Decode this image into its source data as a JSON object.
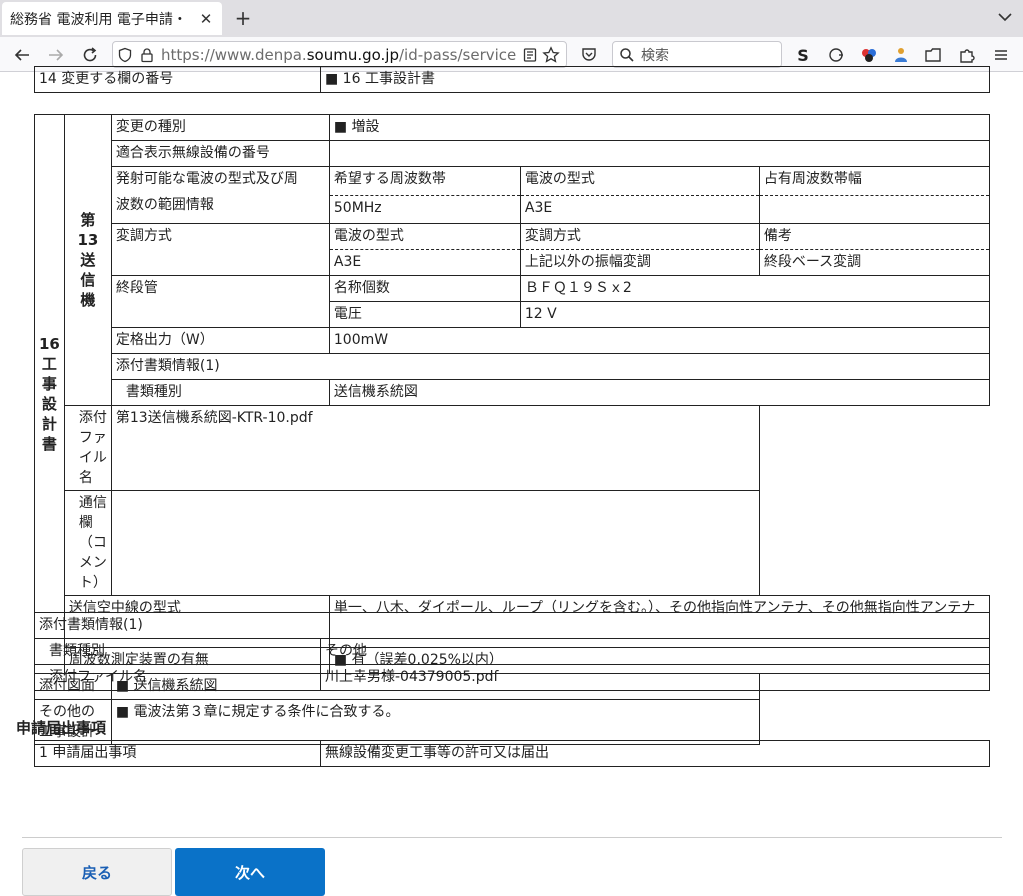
{
  "browser": {
    "tab_title": "総務省 電波利用 電子申請・",
    "close_glyph": "✕",
    "newtab_glyph": "+",
    "url_prefix": "https://www.denpa.",
    "url_host": "soumu.go.jp",
    "url_path": "/id-pass/service",
    "search_placeholder": "検索",
    "icons": [
      "back-arrow",
      "forward-arrow",
      "reload",
      "shield",
      "lock",
      "reader",
      "star",
      "pocket",
      "search",
      "ext-s",
      "ext-g",
      "ext-balls",
      "ext-puzzle-person",
      "container",
      "extensions",
      "menu"
    ]
  },
  "top_row": {
    "label": "14 変更する欄の番号",
    "value": "■ 16 工事設計書"
  },
  "design": {
    "outer_label": "16工事設計書",
    "outer_chars": [
      "16",
      "工",
      "事",
      "設",
      "計",
      "書"
    ],
    "tx_chars": [
      "第",
      "13",
      "送",
      "信",
      "機"
    ],
    "change_type_label": "変更の種別",
    "change_type_value": "■ 増設",
    "conform_label": "適合表示無線設備の番号",
    "conform_value": "",
    "freq_label": "発射可能な電波の型式及び周波数の範囲情報",
    "freq_label_line1": "発射可能な電波の型式及び周",
    "freq_label_line2": "波数の範囲情報",
    "freq_headers": [
      "希望する周波数帯",
      "電波の型式",
      "占有周波数帯幅"
    ],
    "freq_values": [
      "50MHz",
      "A3E",
      ""
    ],
    "mod_label": "変調方式",
    "mod_headers": [
      "電波の型式",
      "変調方式",
      "備考"
    ],
    "mod_values": [
      "A3E",
      "上記以外の振幅変調",
      "終段ベース変調"
    ],
    "final_label": "終段管",
    "final_name_label": "名称個数",
    "final_name_value": "ＢＦＱ１９Ｓｘ2",
    "final_volt_label": "電圧",
    "final_volt_value": "12 V",
    "power_label": "定格出力（W）",
    "power_value": "100mW",
    "attach_title": "添付書類情報(1)",
    "attach_kind_label": "書類種別",
    "attach_kind_value": "送信機系統図",
    "attach_file_label": "添付ファイル名",
    "attach_file_value": "第13送信機系統図-KTR-10.pdf",
    "comment_label": "通信欄（コメント）",
    "comment_value": "",
    "antenna_label": "送信空中線の型式",
    "antenna_value": "単一、八木、ダイポール、ループ（リングを含む。）、その他指向性アンテナ、その他無指向性アンテナ",
    "freqmeter_label": "周波数測定装置の有無",
    "freqmeter_value": "■ 有（誤差0.025%以内）",
    "drawing_label": "添付図面",
    "drawing_value": "■ 送信機系統図",
    "other_label": "その他の工事設計",
    "other_value": "■ 電波法第３章に規定する条件に合致する。"
  },
  "attach2": {
    "title": "添付書類情報(1)",
    "kind_label": "書類種別",
    "kind_value": "その他",
    "file_label": "添付ファイル名",
    "file_value": "川上幸男様-04379005.pdf"
  },
  "application": {
    "section_title": "申請届出事項",
    "row_label": "1 申請届出事項",
    "row_value": "無線設備変更工事等の許可又は届出"
  },
  "buttons": {
    "back": "戻る",
    "next": "次へ"
  },
  "colors": {
    "primary": "#0a72c8",
    "back_text": "#1a5fb4"
  }
}
